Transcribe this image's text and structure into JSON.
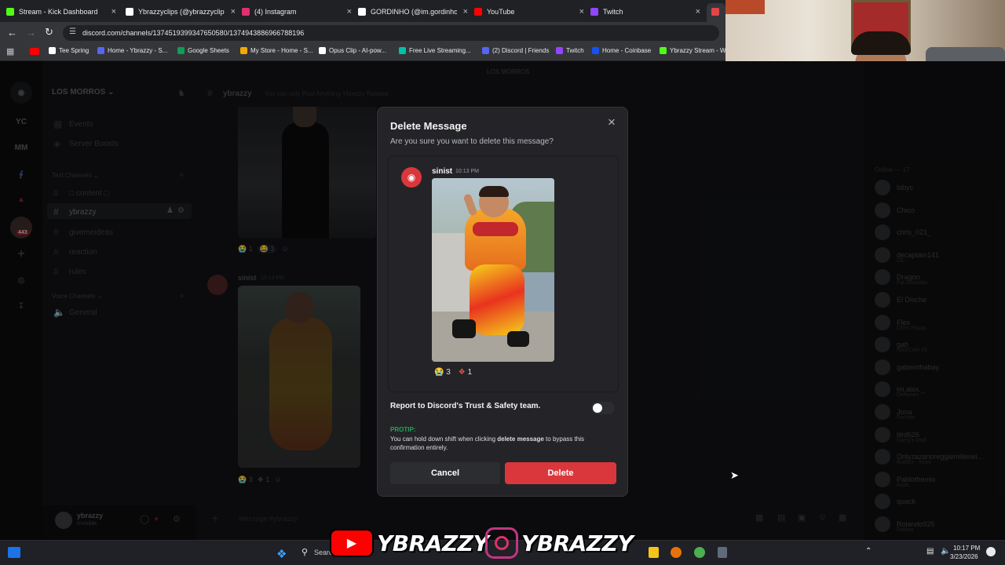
{
  "tabs": [
    {
      "title": "Stream - Kick Dashboard",
      "color": "#53fc18"
    },
    {
      "title": "Ybrazzyclips (@ybrazzyclips)",
      "color": "#ffffff"
    },
    {
      "title": "(4) Instagram",
      "color": "#e1306c"
    },
    {
      "title": "GORDINHO (@im.gordinho)",
      "color": "#ffffff"
    },
    {
      "title": "YouTube",
      "color": "#ff0000"
    },
    {
      "title": "Twitch",
      "color": "#9146ff"
    }
  ],
  "url": "discord.com/channels/1374519399347650580/1374943886966788196",
  "bookmarks": [
    {
      "label": "Tee Spring",
      "color": "#ffffff"
    },
    {
      "label": "Home - Ybrazzy - S...",
      "color": "#5865f2"
    },
    {
      "label": "Google Sheets",
      "color": "#0f9d58"
    },
    {
      "label": "My Store - Home - S...",
      "color": "#f2a900"
    },
    {
      "label": "Opus Clip - AI-pow...",
      "color": "#ffffff"
    },
    {
      "label": "Free Live Streaming...",
      "color": "#00c2a8"
    },
    {
      "label": "(2) Discord | Friends",
      "color": "#5865f2"
    },
    {
      "label": "Twitch",
      "color": "#9146ff"
    },
    {
      "label": "Home - Coinbase",
      "color": "#1652f0"
    },
    {
      "label": "Ybrazzy Stream - W...",
      "color": "#53fc18"
    }
  ],
  "server": {
    "name": "LOS MORROS",
    "top_label": "LOS MORROS",
    "rail": [
      "YC",
      "MM"
    ],
    "badge": "443"
  },
  "sidebar": {
    "events": "Events",
    "boosts": "Server Boosts",
    "text_header": "Text Channels",
    "channels": [
      "content",
      "ybrazzy",
      "givemeideas",
      "reaction",
      "rules"
    ],
    "voice_header": "Voice Channels",
    "voice": [
      "General"
    ]
  },
  "user": {
    "name": "ybrazzy",
    "status": "Invisible"
  },
  "channel_header": {
    "name": "ybrazzy",
    "topic": "You can only Post Anything Ybrazzy Related"
  },
  "chat": {
    "author": "sinist",
    "time": "10:13 PM",
    "reactions1": [
      "1",
      "1"
    ],
    "reactions2": [
      "3",
      "1"
    ],
    "composer_placeholder": "Message #ybrazzy"
  },
  "members": {
    "header": "Online — 17",
    "list": [
      {
        "name": "bibyc",
        "sub": ""
      },
      {
        "name": "Chico",
        "sub": ""
      },
      {
        "name": "chris_021_",
        "sub": ""
      },
      {
        "name": "decaptain141",
        "sub": "DC"
      },
      {
        "name": "Dragon",
        "sub": "Fat Godzilas"
      },
      {
        "name": "El Dische",
        "sub": ""
      },
      {
        "name": "Flex",
        "sub": "Chris Pacas"
      },
      {
        "name": "gab",
        "sub": "NASCAR 25"
      },
      {
        "name": "gabeinthabay",
        "sub": ""
      },
      {
        "name": "im.alex._",
        "sub": "Deftones"
      },
      {
        "name": "Jona",
        "sub": "Fortnite"
      },
      {
        "name": "lilrd626",
        "sub": "Garry's Mod"
      },
      {
        "name": "Onlyzazanoreggiemillerwi...",
        "sub": "Roblox - Xbox"
      },
      {
        "name": "Pablothemix",
        "sub": "Aura"
      },
      {
        "name": "quack",
        "sub": ""
      },
      {
        "name": "Rolando925",
        "sub": "Roblox"
      }
    ]
  },
  "modal": {
    "title": "Delete Message",
    "question": "Are you sure you want to delete this message?",
    "author": "sinist",
    "time": "10:13 PM",
    "reaction_counts": [
      "3",
      "1"
    ],
    "report_label": "Report to Discord's Trust & Safety team.",
    "protip_label": "PROTIP:",
    "protip_pre": "You can hold down shift when clicking ",
    "protip_bold": "delete message",
    "protip_post": " to bypass this confirmation entirely.",
    "cancel": "Cancel",
    "delete": "Delete",
    "delete_color": "#da373c"
  },
  "taskbar": {
    "search": "Search",
    "time": "10:17 PM",
    "date": "3/23/2026"
  },
  "overlay": {
    "yt_handle": "YBRAZZY",
    "ig_handle": "YBRAZZY"
  }
}
